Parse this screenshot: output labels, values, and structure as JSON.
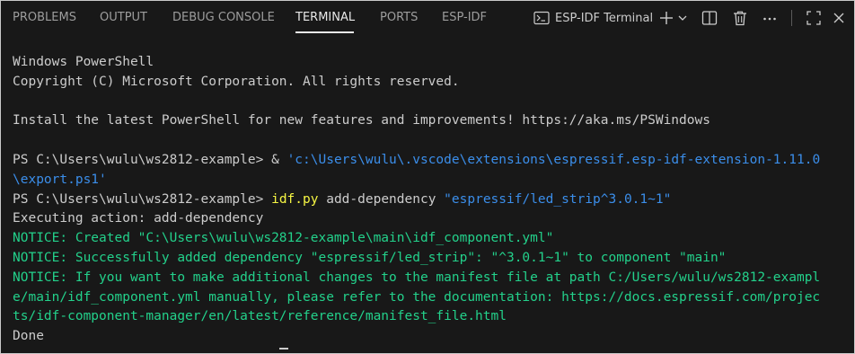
{
  "panel": {
    "tabs": [
      {
        "label": "PROBLEMS"
      },
      {
        "label": "OUTPUT"
      },
      {
        "label": "DEBUG CONSOLE"
      },
      {
        "label": "TERMINAL"
      },
      {
        "label": "PORTS"
      },
      {
        "label": "ESP-IDF"
      }
    ],
    "active_tab": "TERMINAL",
    "terminal_name": "ESP-IDF Terminal",
    "icons": [
      "terminal-icon",
      "plus-icon",
      "chevron-down-icon",
      "split-icon",
      "trash-icon",
      "more-icon",
      "maximize-icon",
      "close-icon"
    ]
  },
  "terminal": {
    "header1": "Windows PowerShell",
    "header2": "Copyright (C) Microsoft Corporation. All rights reserved.",
    "install": "Install the latest PowerShell for new features and improvements! https://aka.ms/PSWindows",
    "prompt": "PS C:\\Users\\wulu\\ws2812-example> ",
    "cmd1_op": "& ",
    "cmd1_path_a": "'c:\\Users\\wulu\\.vscode\\extensions\\espressif.esp-idf-extension-1.11.0",
    "cmd1_path_b": "\\export.ps1'",
    "cmd2_prog": "idf.py",
    "cmd2_args": " add-dependency ",
    "cmd2_pkg": "\"espressif/led_strip^3.0.1~1\"",
    "executing": "Executing action: add-dependency",
    "notice1": "NOTICE: Created \"C:\\Users\\wulu\\ws2812-example\\main\\idf_component.yml\"",
    "notice2": "NOTICE: Successfully added dependency \"espressif/led_strip\": \"^3.0.1~1\" to component \"main\"",
    "notice3a": "NOTICE: If you want to make additional changes to the manifest file at path C:/Users/wulu/ws2812-exampl",
    "notice3b": "e/main/idf_component.yml manually, please refer to the documentation: https://docs.espressif.com/projec",
    "notice3c": "ts/idf-component-manager/en/latest/reference/manifest_file.html",
    "done": "Done"
  },
  "colors": {
    "background": "#181818",
    "text": "#cccccc",
    "notice": "#23d18b",
    "string": "#3b8eea",
    "command": "#f5f543",
    "inactive_tab": "#9d9d9d",
    "active_tab": "#e7e7e7"
  }
}
